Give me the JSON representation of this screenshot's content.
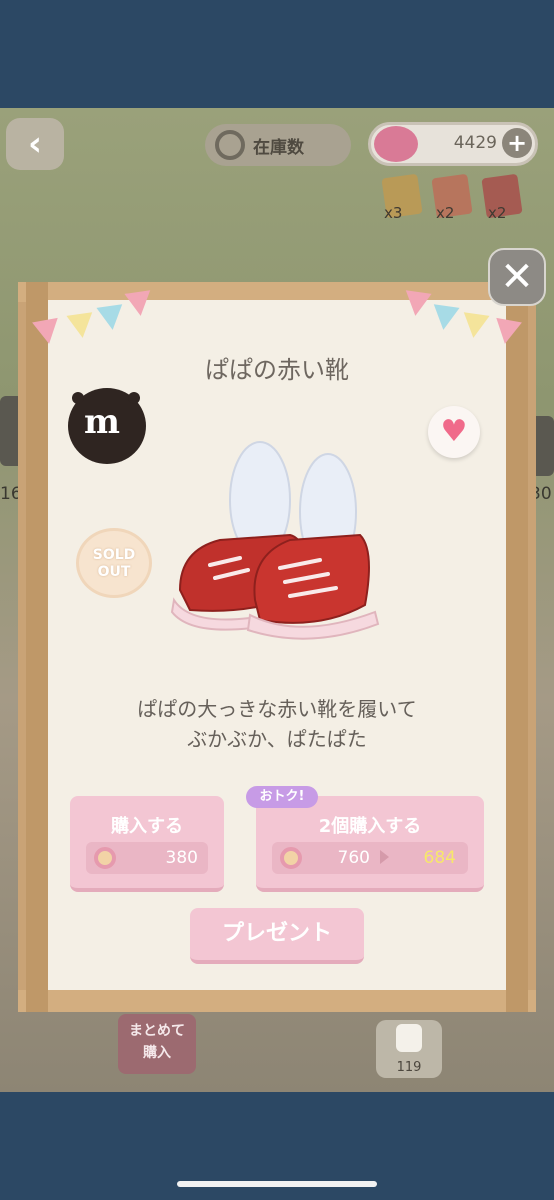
{
  "header": {
    "stock_label": "在庫数",
    "donut_count": "4429",
    "plus_label": "+",
    "tickets": [
      {
        "label": "x3"
      },
      {
        "label": "x2"
      },
      {
        "label": "x2"
      }
    ]
  },
  "background": {
    "side_left_number": "16",
    "side_right_number": "30",
    "bulk_buy_label_line1": "まとめて",
    "bulk_buy_label_line2": "購入",
    "like_count": "119"
  },
  "modal": {
    "close_label": "✕",
    "item_title": "ぱぱの赤い靴",
    "sold_out_line1": "SOLD",
    "sold_out_line2": "OUT",
    "description_line1": "ぱぱの大っきな赤い靴を履いて",
    "description_line2": "ぶかぶか、ぱたぱた",
    "buy_one": {
      "label": "購入する",
      "price": "380"
    },
    "buy_two": {
      "badge": "おトク!",
      "label": "2個購入する",
      "original_price": "760",
      "discount_price": "684"
    },
    "present_label": "プレゼント"
  },
  "colors": {
    "button_pink": "#f3c6d3",
    "discount_price": "#f7e86a",
    "shoe_red": "#c0312c",
    "heart": "#f06a8a"
  }
}
